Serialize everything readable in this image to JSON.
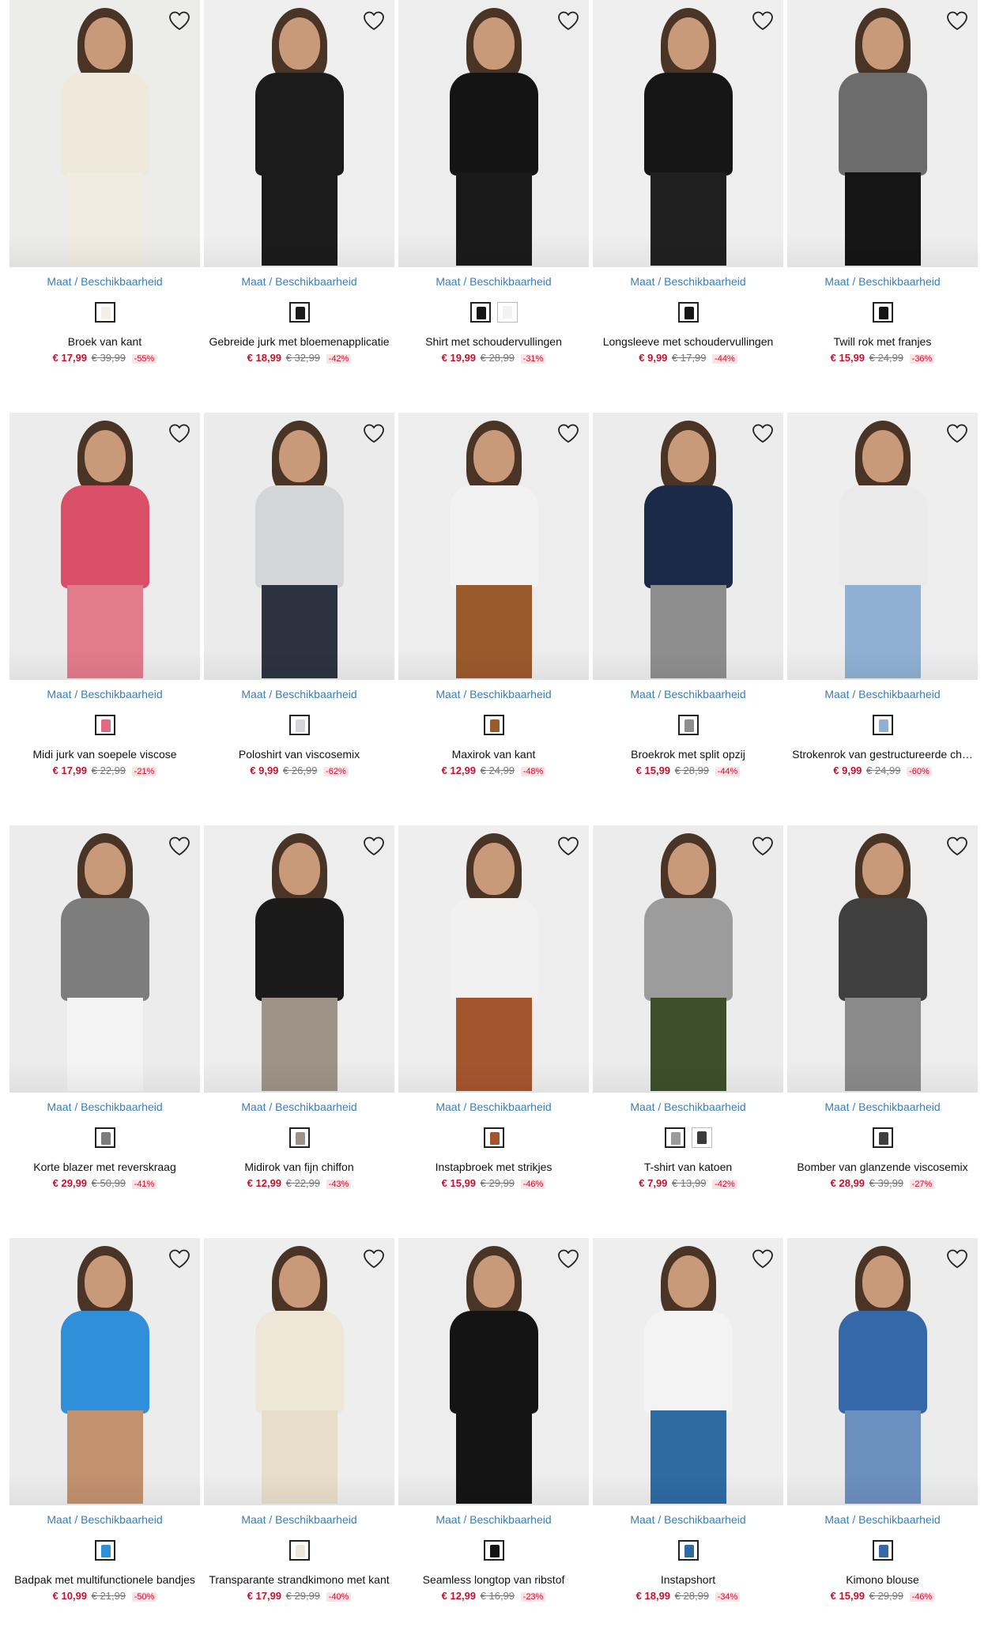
{
  "availability_label": "Maat / Beschikbaarheid",
  "products": [
    {
      "name": "Broek van kant",
      "price": "€ 17,99",
      "old_price": "€ 39,99",
      "discount": "-55%",
      "bg": "#ececea",
      "top": "#efe9dc",
      "bottom": "#f1ece0",
      "swatches": [
        "#f3efe6"
      ]
    },
    {
      "name": "Gebreide jurk met bloemenapplicatie",
      "price": "€ 18,99",
      "old_price": "€ 32,99",
      "discount": "-42%",
      "bg": "#efefef",
      "top": "#1b1b1b",
      "bottom": "#1b1b1b",
      "swatches": [
        "#1b1b1b"
      ]
    },
    {
      "name": "Shirt met schoudervullingen",
      "price": "€ 19,99",
      "old_price": "€ 28,99",
      "discount": "-31%",
      "bg": "#ededed",
      "top": "#141414",
      "bottom": "#1a1a1a",
      "swatches": [
        "#141414",
        "#f2f2f2"
      ]
    },
    {
      "name": "Longsleeve met schoudervullingen",
      "price": "€ 9,99",
      "old_price": "€ 17,99",
      "discount": "-44%",
      "bg": "#efefef",
      "top": "#161616",
      "bottom": "#202020",
      "swatches": [
        "#161616"
      ]
    },
    {
      "name": "Twill rok met franjes",
      "price": "€ 15,99",
      "old_price": "€ 24,99",
      "discount": "-36%",
      "bg": "#eeeeee",
      "top": "#6c6c6c",
      "bottom": "#151515",
      "swatches": [
        "#151515"
      ]
    },
    {
      "name": "Midi jurk van soepele viscose",
      "price": "€ 17,99",
      "old_price": "€ 22,99",
      "discount": "-21%",
      "bg": "#ececec",
      "top": "#d94f68",
      "bottom": "#e27b8c",
      "swatches": [
        "#e06a80"
      ]
    },
    {
      "name": "Poloshirt van viscosemix",
      "price": "€ 9,99",
      "old_price": "€ 26,99",
      "discount": "-62%",
      "bg": "#ebebeb",
      "top": "#d3d5d8",
      "bottom": "#2b3340",
      "swatches": [
        "#d3d5d8"
      ]
    },
    {
      "name": "Maxirok van kant",
      "price": "€ 12,99",
      "old_price": "€ 24,99",
      "discount": "-48%",
      "bg": "#ededed",
      "top": "#f2f2f2",
      "bottom": "#9a5a2c",
      "swatches": [
        "#9a5a2c"
      ]
    },
    {
      "name": "Broekrok met split opzij",
      "price": "€ 15,99",
      "old_price": "€ 28,99",
      "discount": "-44%",
      "bg": "#ececec",
      "top": "#1c2a4a",
      "bottom": "#8e8e8e",
      "swatches": [
        "#8e8e8e"
      ]
    },
    {
      "name": "Strokenrok van gestructureerde ch…",
      "price": "€ 9,99",
      "old_price": "€ 24,99",
      "discount": "-60%",
      "bg": "#eeeeee",
      "top": "#eaeaea",
      "bottom": "#8fb0d2",
      "swatches": [
        "#8fb0d2"
      ]
    },
    {
      "name": "Korte blazer met reverskraag",
      "price": "€ 29,99",
      "old_price": "€ 50,99",
      "discount": "-41%",
      "bg": "#ececec",
      "top": "#7d7d7d",
      "bottom": "#f4f4f4",
      "swatches": [
        "#7d7d7d"
      ]
    },
    {
      "name": "Midirok van fijn chiffon",
      "price": "€ 12,99",
      "old_price": "€ 22,99",
      "discount": "-43%",
      "bg": "#ededed",
      "top": "#1a1a1a",
      "bottom": "#9d9387",
      "swatches": [
        "#9d9387"
      ]
    },
    {
      "name": "Instapbroek met strikjes",
      "price": "€ 15,99",
      "old_price": "€ 29,99",
      "discount": "-46%",
      "bg": "#eeeeee",
      "top": "#f1f1f1",
      "bottom": "#a5552e",
      "swatches": [
        "#a5552e"
      ]
    },
    {
      "name": "T-shirt van katoen",
      "price": "€ 7,99",
      "old_price": "€ 13,99",
      "discount": "-42%",
      "bg": "#ececec",
      "top": "#9c9c9c",
      "bottom": "#3d4f2a",
      "swatches": [
        "#9c9c9c",
        "#3b3b3b"
      ]
    },
    {
      "name": "Bomber van glanzende viscosemix",
      "price": "€ 28,99",
      "old_price": "€ 39,99",
      "discount": "-27%",
      "bg": "#ededed",
      "top": "#3f3f3f",
      "bottom": "#8a8a8a",
      "swatches": [
        "#3f3f3f"
      ]
    },
    {
      "name": "Badpak met multifunctionele bandjes",
      "price": "€ 10,99",
      "old_price": "€ 21,99",
      "discount": "-50%",
      "bg": "#ececec",
      "top": "#2f8fd8",
      "bottom": "#c2916e",
      "swatches": [
        "#2f8fd8"
      ]
    },
    {
      "name": "Transparante strandkimono met kant",
      "price": "€ 17,99",
      "old_price": "€ 29,99",
      "discount": "-40%",
      "bg": "#eeeeee",
      "top": "#eee6d7",
      "bottom": "#e8ddc8",
      "swatches": [
        "#eee6d7"
      ]
    },
    {
      "name": "Seamless longtop van ribstof",
      "price": "€ 12,99",
      "old_price": "€ 16,99",
      "discount": "-23%",
      "bg": "#ededed",
      "top": "#141414",
      "bottom": "#141414",
      "swatches": [
        "#141414"
      ]
    },
    {
      "name": "Instapshort",
      "price": "€ 18,99",
      "old_price": "€ 28,99",
      "discount": "-34%",
      "bg": "#eeeeee",
      "top": "#f3f3f3",
      "bottom": "#2f6aa3",
      "swatches": [
        "#2f6aa3"
      ]
    },
    {
      "name": "Kimono blouse",
      "price": "€ 15,99",
      "old_price": "€ 29,99",
      "discount": "-46%",
      "bg": "#ececec",
      "top": "#3468a8",
      "bottom": "#6b8fbf",
      "swatches": [
        "#3468a8"
      ]
    }
  ]
}
